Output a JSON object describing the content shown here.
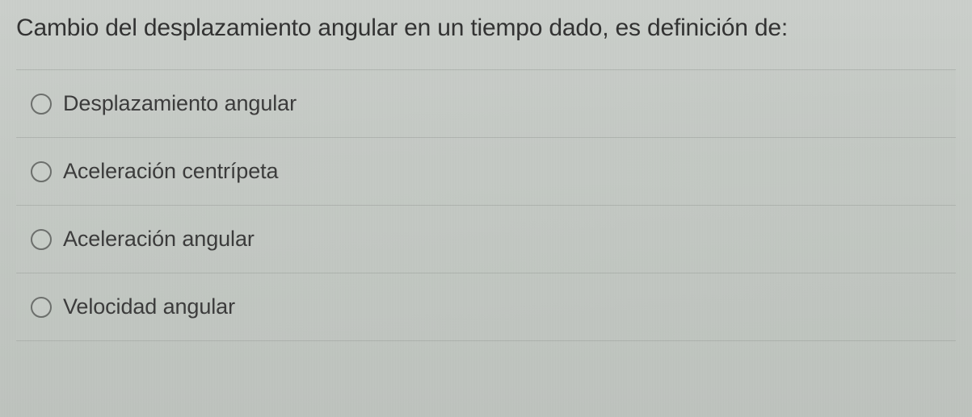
{
  "question": {
    "text": "Cambio del desplazamiento angular en un tiempo dado, es definición de:"
  },
  "options": [
    {
      "label": "Desplazamiento angular"
    },
    {
      "label": "Aceleración centrípeta"
    },
    {
      "label": "Aceleración angular"
    },
    {
      "label": "Velocidad angular"
    }
  ]
}
